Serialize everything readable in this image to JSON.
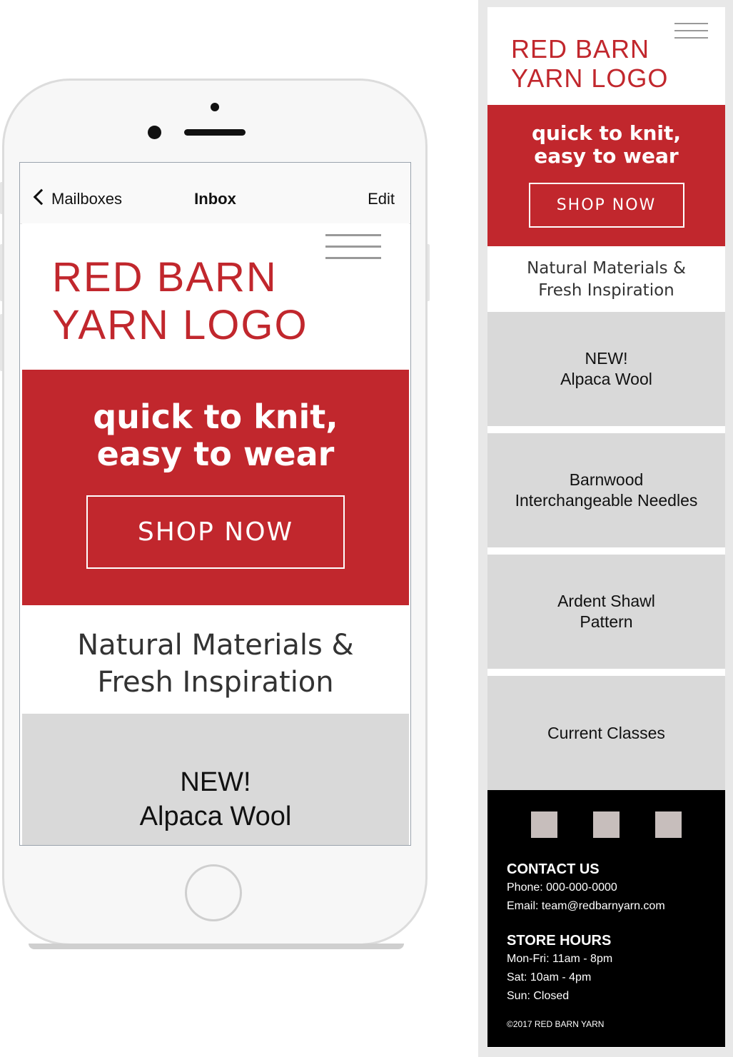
{
  "mail_nav": {
    "back_label": "Mailboxes",
    "title": "Inbox",
    "edit_label": "Edit"
  },
  "email": {
    "logo_line1": "RED BARN",
    "logo_line2": "YARN LOGO",
    "promo_line1": "quick to knit,",
    "promo_line2": "easy to wear",
    "shop_button": "SHOP NOW",
    "tagline_line1": "Natural Materials &",
    "tagline_line2": "Fresh Inspiration",
    "products": [
      {
        "line1": "NEW!",
        "line2": "Alpaca Wool"
      },
      {
        "line1": "Barnwood",
        "line2": "Interchangeable Needles"
      },
      {
        "line1": "Ardent Shawl",
        "line2": "Pattern"
      },
      {
        "line1": "Current Classes",
        "line2": ""
      }
    ],
    "footer": {
      "contact_heading": "CONTACT US",
      "phone": "Phone: 000-000-0000",
      "email": "Email: team@redbarnyarn.com",
      "hours_heading": "STORE HOURS",
      "hours": [
        "Mon-Fri: 11am - 8pm",
        "Sat: 10am - 4pm",
        "Sun: Closed"
      ],
      "copyright": "©2017 RED BARN YARN"
    }
  },
  "colors": {
    "brand_red": "#c1272d",
    "product_gray": "#d9d9d9",
    "footer_black": "#000000",
    "social_icon": "#c7bebc"
  }
}
